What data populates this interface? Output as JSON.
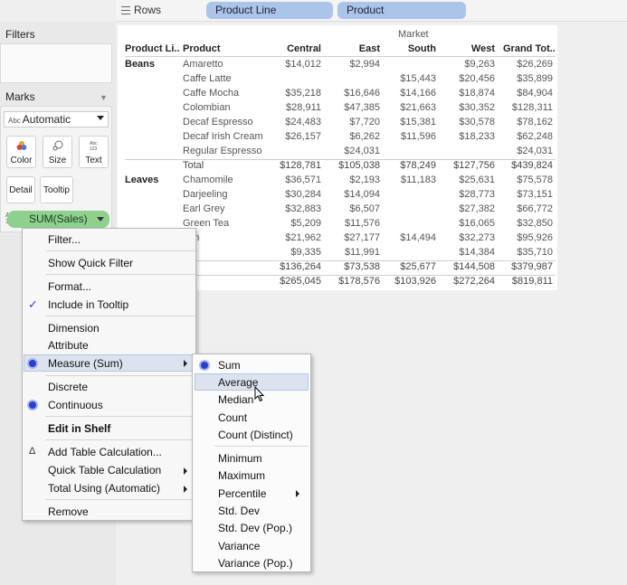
{
  "rows_shelf": {
    "label": "Rows",
    "pills": [
      "Product Line",
      "Product"
    ]
  },
  "sidebar": {
    "filters_title": "Filters",
    "marks_title": "Marks",
    "mark_type_abc": "Abc",
    "mark_type": "Automatic",
    "buttons": [
      "Color",
      "Size",
      "Text",
      "Detail",
      "Tooltip"
    ],
    "field_pill": "SUM(Sales)",
    "pill_type_icon": "Abc 123"
  },
  "table": {
    "market_header": "Market",
    "col_headers": [
      "Product Li..",
      "Product",
      "Central",
      "East",
      "South",
      "West",
      "Grand Tot.."
    ],
    "groups": [
      {
        "name": "Beans",
        "rows": [
          [
            "Amaretto",
            "$14,012",
            "$2,994",
            "",
            "$9,263",
            "$26,269"
          ],
          [
            "Caffe Latte",
            "",
            "",
            "$15,443",
            "$20,456",
            "$35,899"
          ],
          [
            "Caffe Mocha",
            "$35,218",
            "$16,646",
            "$14,166",
            "$18,874",
            "$84,904"
          ],
          [
            "Colombian",
            "$28,911",
            "$47,385",
            "$21,663",
            "$30,352",
            "$128,311"
          ],
          [
            "Decaf Espresso",
            "$24,483",
            "$7,720",
            "$15,381",
            "$30,578",
            "$78,162"
          ],
          [
            "Decaf Irish Cream",
            "$26,157",
            "$6,262",
            "$11,596",
            "$18,233",
            "$62,248"
          ],
          [
            "Regular Espresso",
            "",
            "$24,031",
            "",
            "",
            "$24,031"
          ]
        ],
        "total": [
          "Total",
          "$128,781",
          "$105,038",
          "$78,249",
          "$127,756",
          "$439,824"
        ]
      },
      {
        "name": "Leaves",
        "rows": [
          [
            "Chamomile",
            "$36,571",
            "$2,193",
            "$11,183",
            "$25,631",
            "$75,578"
          ],
          [
            "Darjeeling",
            "$30,284",
            "$14,094",
            "",
            "$28,773",
            "$73,151"
          ],
          [
            "Earl Grey",
            "$32,883",
            "$6,507",
            "",
            "$27,382",
            "$66,772"
          ],
          [
            "Green Tea",
            "$5,209",
            "$11,576",
            "",
            "$16,065",
            "$32,850"
          ],
          [
            "non",
            "$21,962",
            "$27,177",
            "$14,494",
            "$32,273",
            "$95,926"
          ],
          [
            "t",
            "$9,335",
            "$11,991",
            "",
            "$14,384",
            "$35,710"
          ]
        ],
        "total": [
          "al",
          "$136,264",
          "$73,538",
          "$25,677",
          "$144,508",
          "$379,987"
        ]
      }
    ],
    "grand_total": [
      "",
      "$265,045",
      "$178,576",
      "$103,926",
      "$272,264",
      "$819,811"
    ]
  },
  "context_menu": {
    "items": {
      "filter": "Filter...",
      "show_quick_filter": "Show Quick Filter",
      "format": "Format...",
      "include_in_tooltip": "Include in Tooltip",
      "dimension": "Dimension",
      "attribute": "Attribute",
      "measure": "Measure (Sum)",
      "discrete": "Discrete",
      "continuous": "Continuous",
      "edit_in_shelf": "Edit in Shelf",
      "add_table_calc": "Add Table Calculation...",
      "quick_table_calc": "Quick Table Calculation",
      "total_using": "Total Using (Automatic)",
      "remove": "Remove"
    },
    "checkmark": "✓",
    "delta": "Δ"
  },
  "measure_submenu": {
    "items": [
      "Sum",
      "Average",
      "Median",
      "Count",
      "Count (Distinct)",
      "Minimum",
      "Maximum",
      "Percentile",
      "Std. Dev",
      "Std. Dev (Pop.)",
      "Variance",
      "Variance (Pop.)"
    ],
    "selected": "Sum",
    "hovered": "Average"
  },
  "colors": {
    "pill_blue": "#aac4ea",
    "pill_green": "#8fd08f",
    "radio_blue": "#2a3ecf",
    "menu_highlight": "#dce3ef"
  }
}
